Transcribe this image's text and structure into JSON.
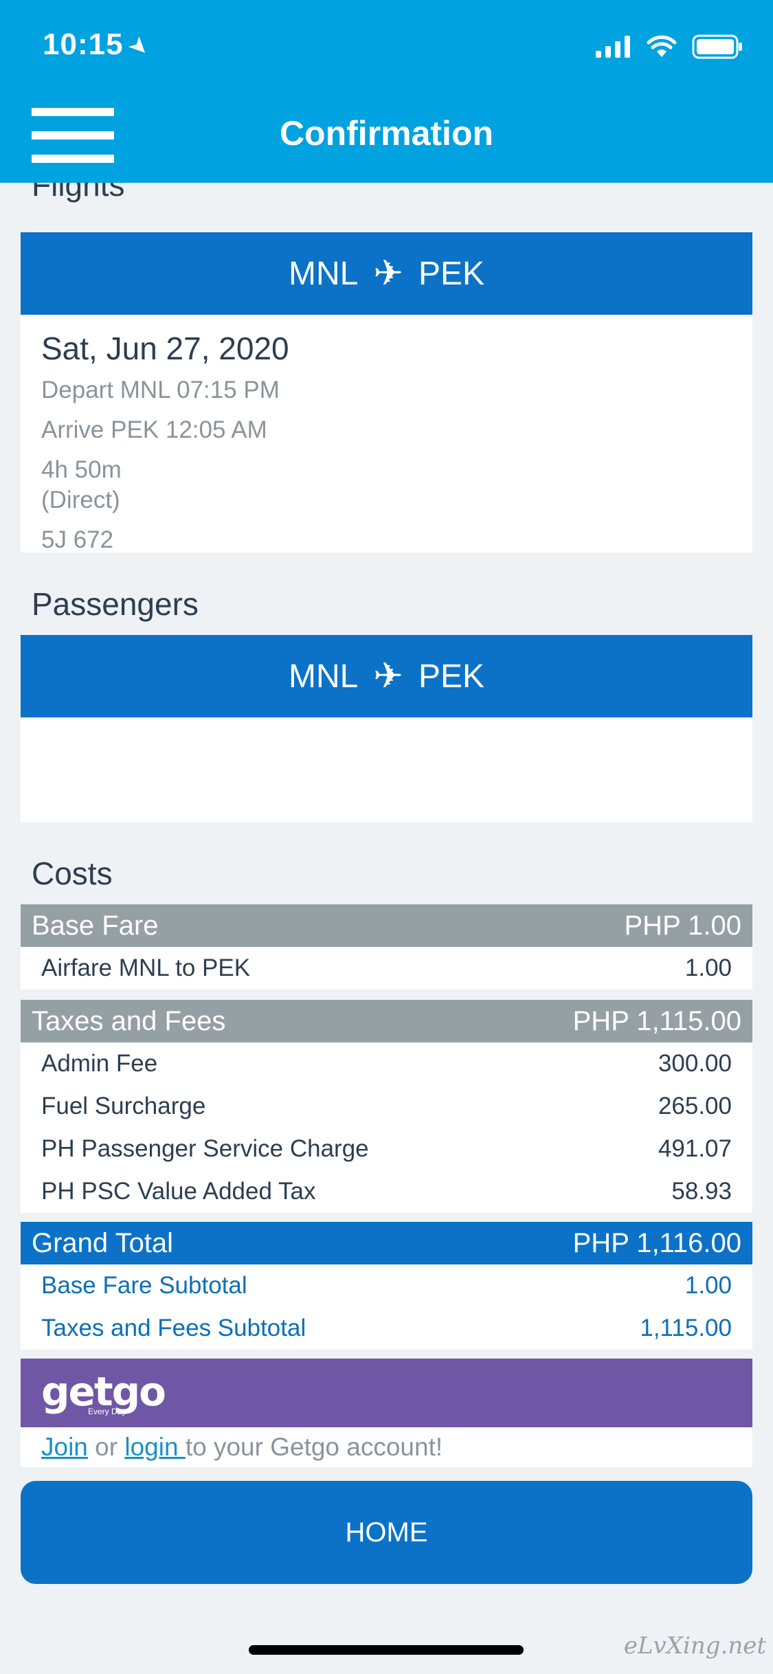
{
  "status_bar": {
    "time": "10:15"
  },
  "nav": {
    "title": "Confirmation"
  },
  "flights": {
    "section_title": "Flights",
    "route": {
      "from": "MNL",
      "to": "PEK"
    },
    "date": "Sat, Jun 27, 2020",
    "depart": "Depart  MNL  07:15 PM",
    "arrive": "Arrive  PEK  12:05 AM",
    "duration": "4h 50m",
    "type": "(Direct)",
    "flight_no": "5J 672"
  },
  "passengers": {
    "section_title": "Passengers",
    "route": {
      "from": "MNL",
      "to": "PEK"
    }
  },
  "costs": {
    "section_title": "Costs",
    "base_fare": {
      "label": "Base Fare",
      "amount": "PHP 1.00",
      "items": [
        {
          "label": "Airfare MNL to PEK",
          "value": "1.00"
        }
      ]
    },
    "taxes": {
      "label": "Taxes and Fees",
      "amount": "PHP 1,115.00",
      "items": [
        {
          "label": "Admin Fee",
          "value": "300.00"
        },
        {
          "label": "Fuel Surcharge",
          "value": "265.00"
        },
        {
          "label": "PH Passenger Service Charge",
          "value": "491.07"
        },
        {
          "label": "PH PSC Value Added Tax",
          "value": "58.93"
        }
      ]
    },
    "grand_total": {
      "label": "Grand Total",
      "amount": "PHP 1,116.00",
      "items": [
        {
          "label": "Base Fare Subtotal",
          "value": "1.00"
        },
        {
          "label": "Taxes and Fees Subtotal",
          "value": "1,115.00"
        }
      ]
    }
  },
  "getgo": {
    "logo": "getgo",
    "logo_sub": "Every Day",
    "join": "Join",
    "or": " or ",
    "login": "login ",
    "suffix": "to your Getgo account!"
  },
  "home_button": "HOME",
  "watermark": "eLvXing.net",
  "colors": {
    "header": "#00a2e0",
    "primary": "#0b72c7",
    "gray_header": "#95a0a4",
    "getgo": "#6f57a5"
  }
}
